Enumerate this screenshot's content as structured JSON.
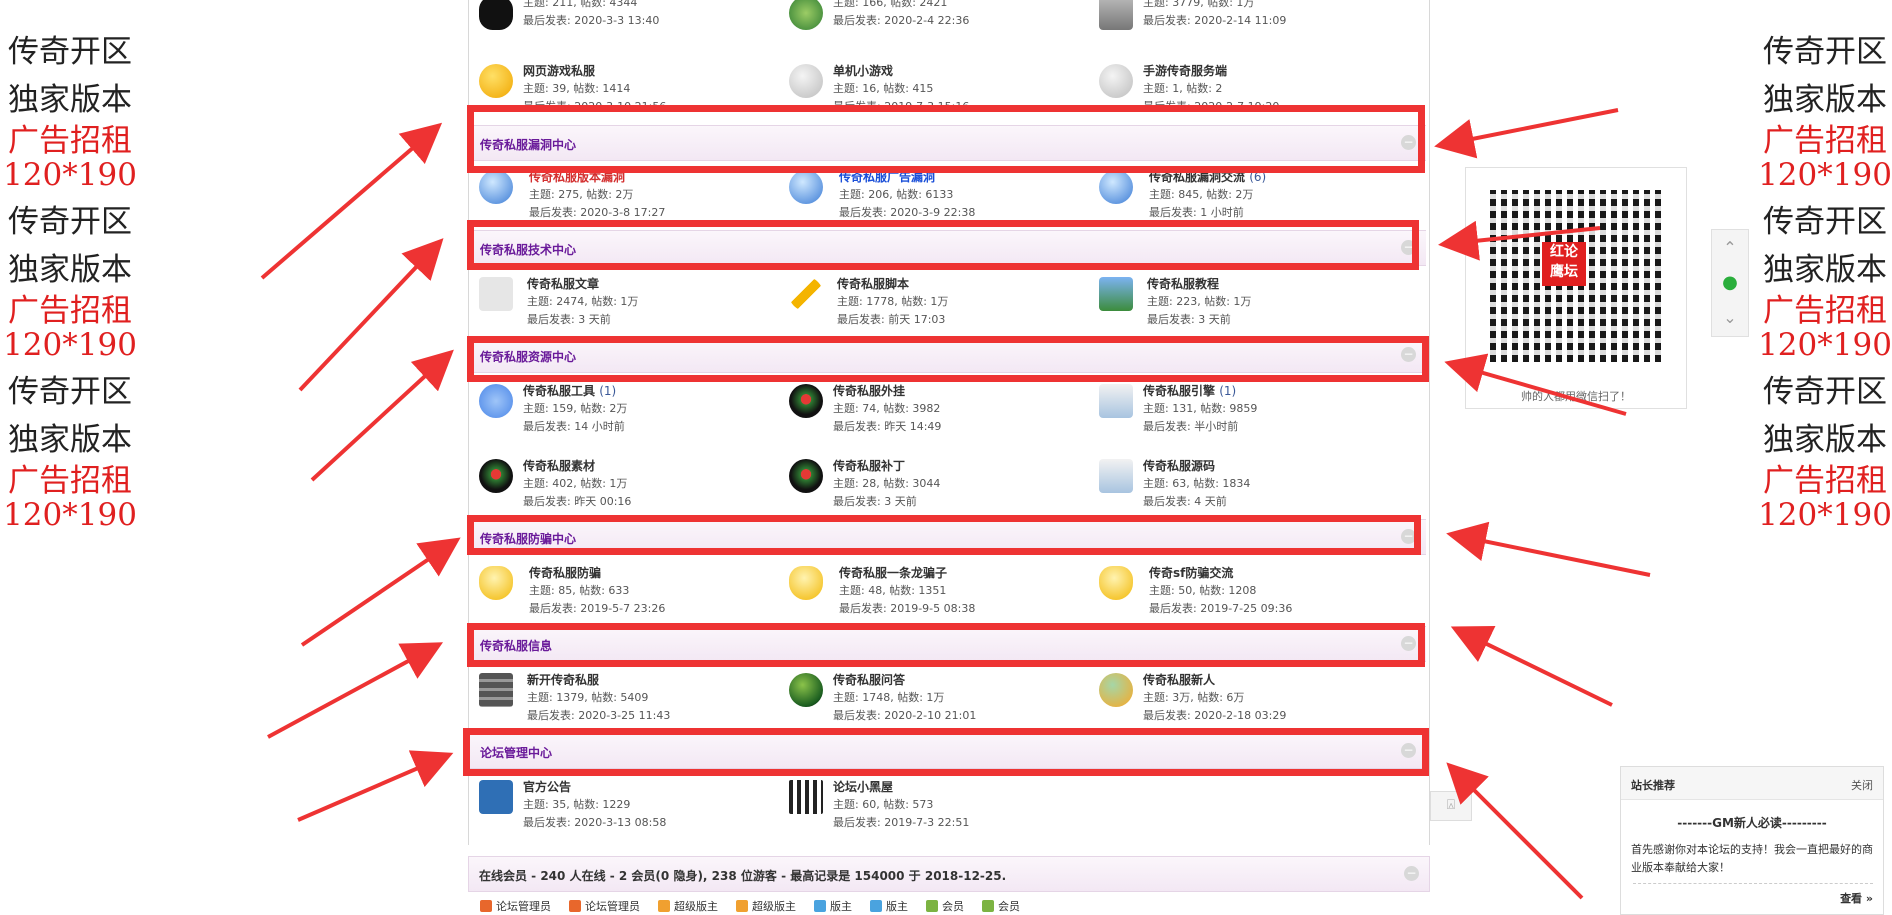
{
  "side_ads": {
    "left": [
      {
        "l1": "传奇开区",
        "l2": "独家版本",
        "r1": "广告招租",
        "r2": "120*190"
      },
      {
        "l1": "传奇开区",
        "l2": "独家版本",
        "r1": "广告招租",
        "r2": "120*190"
      },
      {
        "l1": "传奇开区",
        "l2": "独家版本",
        "r1": "广告招租",
        "r2": "120*190"
      }
    ],
    "right": [
      {
        "l1": "传奇开区",
        "l2": "独家版本",
        "r1": "广告招租",
        "r2": "120*190"
      },
      {
        "l1": "传奇开区",
        "l2": "独家版本",
        "r1": "广告招租",
        "r2": "120*190"
      },
      {
        "l1": "传奇开区",
        "l2": "独家版本",
        "r1": "广告招租",
        "r2": "120*190"
      }
    ]
  },
  "top_row": [
    {
      "icon": "hello-icon",
      "name": "",
      "stats": "主题: 211, 帖数: 4344",
      "last": "最后发表: 2020-3-3 13:40"
    },
    {
      "icon": "chat-icon",
      "name": "",
      "stats": "主题: 166, 帖数: 2421",
      "last": "最后发表: 2020-2-4 22:36"
    },
    {
      "icon": "recycle-bin-icon",
      "name": "",
      "stats": "主题: 3779, 帖数: 1万",
      "last": "最后发表: 2020-2-14 11:09"
    }
  ],
  "row2": [
    {
      "icon": "yellow-bubble-icon",
      "name": "网页游戏私服",
      "stats": "主题: 39, 帖数: 1414",
      "last": "最后发表: 2020-3-10 21:56"
    },
    {
      "icon": "gray-bubble-icon",
      "name": "单机小游戏",
      "stats": "主题: 16, 帖数: 415",
      "last": "最后发表: 2019-7-3 15:16"
    },
    {
      "icon": "gray-bubble-icon",
      "name": "手游传奇服务端",
      "stats": "主题: 1, 帖数: 2",
      "last": "最后发表: 2020-2-7 19:20"
    }
  ],
  "categories": [
    {
      "title": "传奇私服漏洞中心",
      "forums": [
        {
          "icon": "globe-icon",
          "name": "传奇私服版本漏洞",
          "new": "",
          "stats": "主题: 275, 帖数: 2万",
          "last": "最后发表: 2020-3-8 17:27"
        },
        {
          "icon": "globe-icon",
          "name": "传奇私服广告漏洞",
          "new": "",
          "stats": "主题: 206, 帖数: 6133",
          "last": "最后发表: 2020-3-9 22:38"
        },
        {
          "icon": "globe-icon",
          "name": "传奇私服漏洞交流",
          "new": "(6)",
          "stats": "主题: 845, 帖数: 2万",
          "last": "最后发表: 1 小时前"
        }
      ]
    },
    {
      "title": "传奇私服技术中心",
      "forums": [
        {
          "icon": "document-icon",
          "name": "传奇私服文章",
          "new": "",
          "stats": "主题: 2474, 帖数: 1万",
          "last": "最后发表: 3 天前"
        },
        {
          "icon": "pencil-icon",
          "name": "传奇私服脚本",
          "new": "",
          "stats": "主题: 1778, 帖数: 1万",
          "last": "最后发表: 前天 17:03"
        },
        {
          "icon": "people-icon",
          "name": "传奇私服教程",
          "new": "",
          "stats": "主题: 223, 帖数: 1万",
          "last": "最后发表: 3 天前"
        }
      ]
    },
    {
      "title": "传奇私服资源中心",
      "forums": [
        {
          "icon": "gears-icon",
          "name": "传奇私服工具",
          "new": "(1)",
          "stats": "主题: 159, 帖数: 2万",
          "last": "最后发表: 14 小时前"
        },
        {
          "icon": "dark-globe-icon",
          "name": "传奇私服外挂",
          "new": "",
          "stats": "主题: 74, 帖数: 3982",
          "last": "最后发表: 昨天 14:49"
        },
        {
          "icon": "box-icon",
          "name": "传奇私服引擎",
          "new": "(1)",
          "stats": "主题: 131, 帖数: 9859",
          "last": "最后发表: 半小时前"
        },
        {
          "icon": "dark-globe-icon",
          "name": "传奇私服素材",
          "new": "",
          "stats": "主题: 402, 帖数: 1万",
          "last": "最后发表: 昨天 00:16"
        },
        {
          "icon": "dark-globe-icon",
          "name": "传奇私服补丁",
          "new": "",
          "stats": "主题: 28, 帖数: 3044",
          "last": "最后发表: 3 天前"
        },
        {
          "icon": "box-icon",
          "name": "传奇私服源码",
          "new": "",
          "stats": "主题: 63, 帖数: 1834",
          "last": "最后发表: 4 天前"
        }
      ]
    },
    {
      "title": "传奇私服防骗中心",
      "forums": [
        {
          "icon": "shield-icon",
          "name": "传奇私服防骗",
          "new": "",
          "stats": "主题: 85, 帖数: 633",
          "last": "最后发表: 2019-5-7 23:26"
        },
        {
          "icon": "shield-icon",
          "name": "传奇私服一条龙骗子",
          "new": "",
          "stats": "主题: 48, 帖数: 1351",
          "last": "最后发表: 2019-9-5 08:38"
        },
        {
          "icon": "shield-icon",
          "name": "传奇sf防骗交流",
          "new": "",
          "stats": "主题: 50, 帖数: 1208",
          "last": "最后发表: 2019-7-25 09:36"
        }
      ]
    },
    {
      "title": "传奇私服信息",
      "forums": [
        {
          "icon": "server-icon",
          "name": "新开传奇私服",
          "new": "",
          "stats": "主题: 1379, 帖数: 5409",
          "last": "最后发表: 2020-3-25 11:43"
        },
        {
          "icon": "ball-icon",
          "name": "传奇私服问答",
          "new": "",
          "stats": "主题: 1748, 帖数: 1万",
          "last": "最后发表: 2020-2-10 21:01"
        },
        {
          "icon": "chat-bubble-icon",
          "name": "传奇私服新人",
          "new": "",
          "stats": "主题: 3万, 帖数: 6万",
          "last": "最后发表: 2020-2-18 03:29"
        }
      ]
    },
    {
      "title": "论坛管理中心",
      "forums": [
        {
          "icon": "house-icon",
          "name": "官方公告",
          "new": "",
          "stats": "主题: 35, 帖数: 1229",
          "last": "最后发表: 2020-3-13 08:58"
        },
        {
          "icon": "jail-icon",
          "name": "论坛小黑屋",
          "new": "",
          "stats": "主题: 60, 帖数: 573",
          "last": "最后发表: 2019-7-3 22:51"
        }
      ]
    }
  ],
  "online": {
    "text": "在线会员 - 240 人在线 - 2 会员(0 隐身), 238 位游客 - 最高记录是 154000 于 2018-12-25.",
    "roles": [
      {
        "label": "论坛管理员",
        "color": "#e8672c"
      },
      {
        "label": "论坛管理员",
        "color": "#e8672c"
      },
      {
        "label": "超级版主",
        "color": "#f0a030"
      },
      {
        "label": "超级版主",
        "color": "#f0a030"
      },
      {
        "label": "版主",
        "color": "#4aa3df"
      },
      {
        "label": "版主",
        "color": "#4aa3df"
      },
      {
        "label": "会员",
        "color": "#7cb342"
      },
      {
        "label": "会员",
        "color": "#7cb342"
      }
    ]
  },
  "qr": {
    "caption": "帅的人都用微信扫了！",
    "logo_line1": "红论",
    "logo_line2": "鹰坛"
  },
  "recommend": {
    "title": "站长推荐",
    "close": "关闭",
    "heading": "-------GM新人必读---------",
    "body": "首先感谢你对本论坛的支持！我会一直把最好的商业版本奉献给大家！",
    "more": "查看 »"
  },
  "collapse_glyph": "−",
  "colors": {
    "highlight": "#ee3333",
    "category_title": "#6a1b9a",
    "ad_red": "#e02020"
  }
}
